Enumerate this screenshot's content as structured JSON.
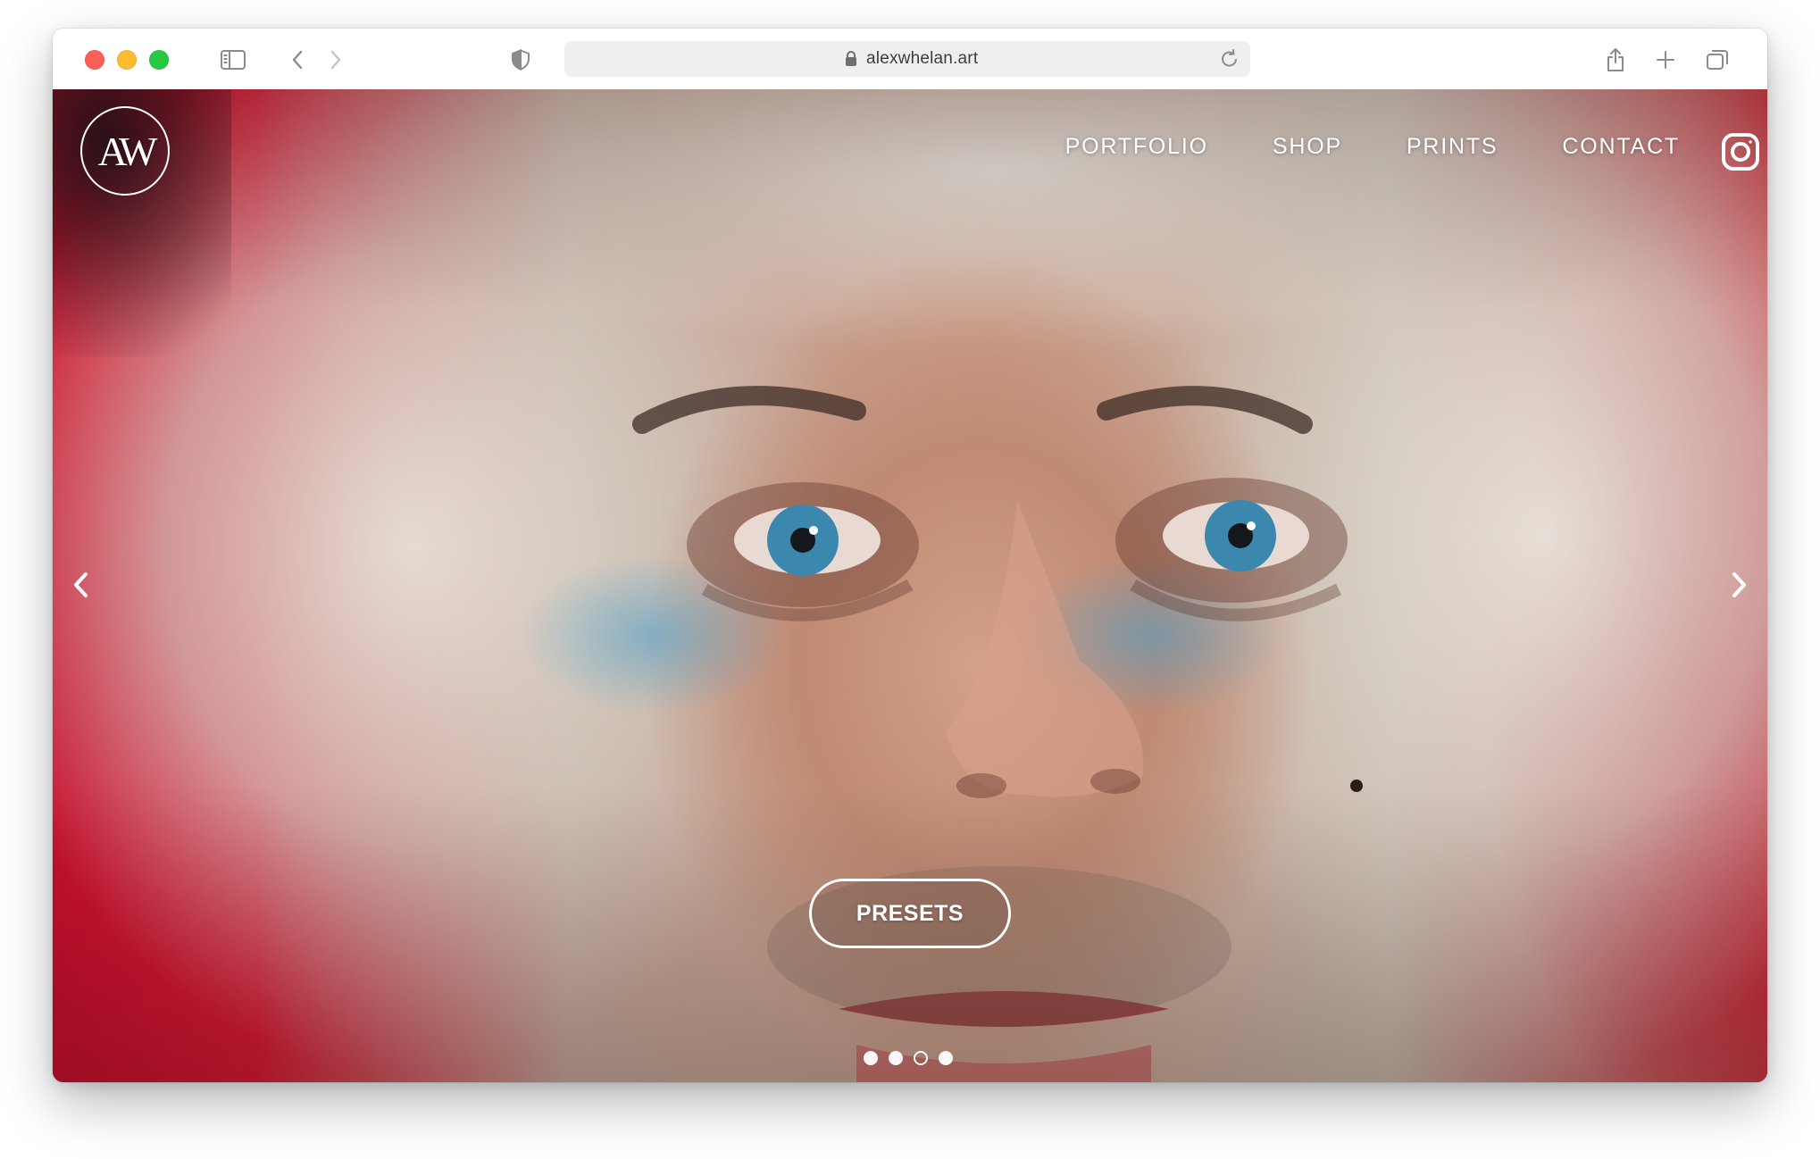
{
  "browser": {
    "url": "alexwhelan.art",
    "controls": {
      "close": "close-button",
      "minimize": "minimize-button",
      "zoom": "zoom-button"
    },
    "colors": {
      "close": "#fe5f57",
      "minimize": "#febc2e",
      "zoom": "#28c840"
    }
  },
  "site": {
    "logo_text": "AW",
    "nav": [
      {
        "label": "PORTFOLIO"
      },
      {
        "label": "SHOP"
      },
      {
        "label": "PRINTS"
      },
      {
        "label": "CONTACT"
      }
    ],
    "social_icon": "instagram-icon"
  },
  "hero": {
    "cta_label": "PRESETS",
    "slides_total": 4,
    "active_slide": 3,
    "prev_icon": "chevron-left-icon",
    "next_icon": "chevron-right-icon"
  }
}
